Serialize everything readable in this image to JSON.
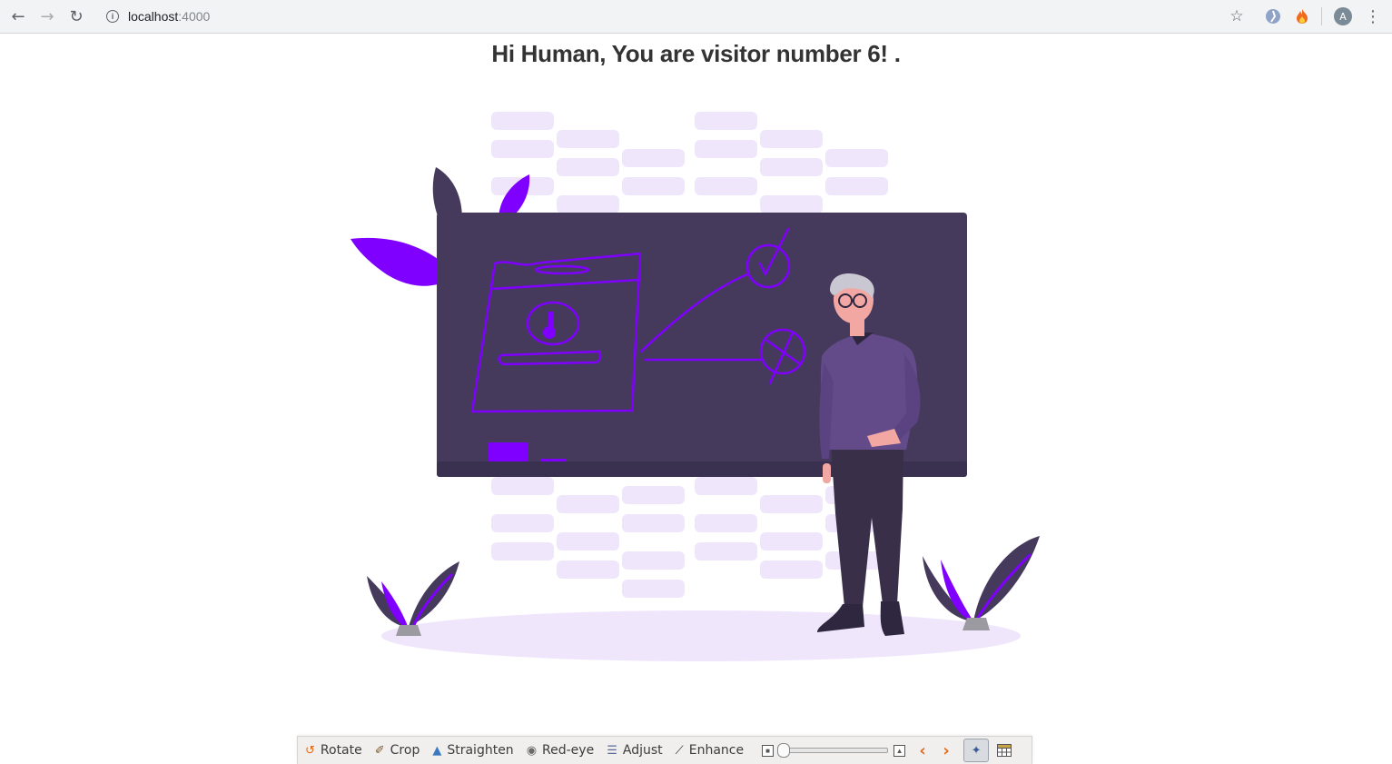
{
  "browser": {
    "url_host": "localhost",
    "url_port": ":4000",
    "profile_initial": "A",
    "icons": [
      "back-arrow-icon",
      "forward-arrow-icon",
      "reload-icon",
      "info-icon",
      "star-icon",
      "extension-icon",
      "fire-extension-icon",
      "menu-dots-icon"
    ]
  },
  "page": {
    "heading": "Hi Human, You are visitor number 6! ."
  },
  "illustration": {
    "accent_color": "#7f00ff",
    "board_color": "#453a5b",
    "light_color": "#efe6fb"
  },
  "photo_toolbar": {
    "items": [
      {
        "label": "Rotate",
        "icon": "rotate-icon"
      },
      {
        "label": "Crop",
        "icon": "crop-icon"
      },
      {
        "label": "Straighten",
        "icon": "straighten-icon"
      },
      {
        "label": "Red-eye",
        "icon": "red-eye-icon"
      },
      {
        "label": "Adjust",
        "icon": "adjust-icon"
      },
      {
        "label": "Enhance",
        "icon": "enhance-icon"
      }
    ],
    "zoom_level": 0.03
  }
}
